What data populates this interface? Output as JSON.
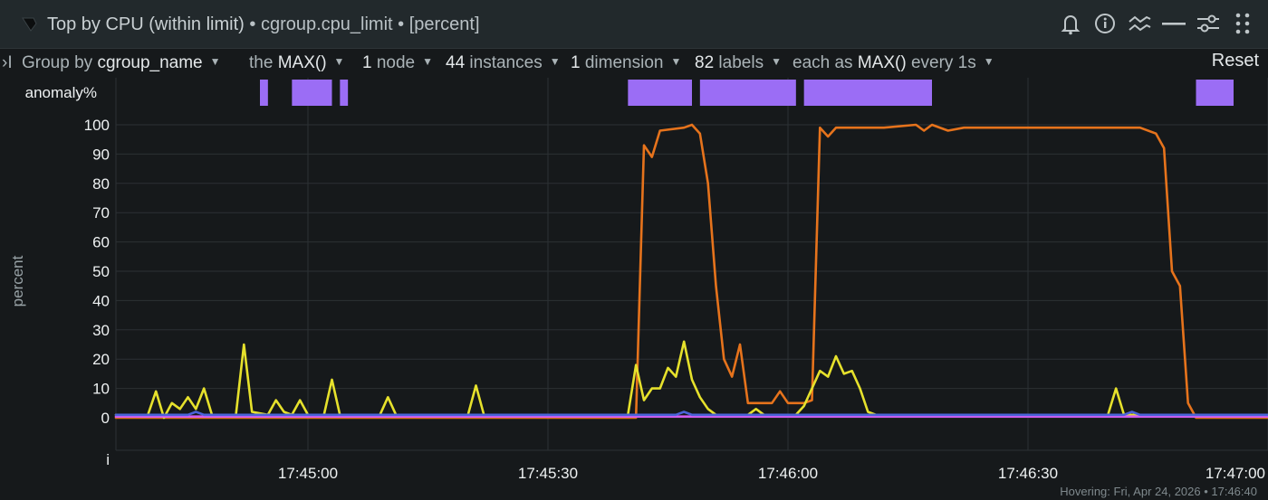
{
  "header": {
    "title_main": "Top by CPU (within limit)",
    "title_context": "• cgroup.cpu_limit",
    "title_units": "• [percent]",
    "icons": [
      "alert-bell-icon",
      "info-icon",
      "correlate-icon",
      "minimize-icon",
      "settings-sliders-icon",
      "drag-handle-icon"
    ]
  },
  "toolbar": {
    "expand_label": "›I",
    "group_by_label": "Group by",
    "group_by_value": "cgroup_name",
    "the_label": "the",
    "aggregation_value": "MAX()",
    "nodes_count": "1",
    "nodes_label": "node",
    "instances_count": "44",
    "instances_label": "instances",
    "dimensions_count": "1",
    "dimensions_label": "dimension",
    "labels_count": "82",
    "labels_label": "labels",
    "each_as_label": "each as",
    "time_agg_value": "MAX()",
    "every_label": "every 1s",
    "reset_label": "Reset"
  },
  "footer": {
    "hovering_text": "Hovering:  Fri, Apr 24, 2026 • 17:46:40"
  },
  "colors": {
    "background": "#16191b",
    "grid": "#2c3134",
    "anomaly": "#9b6df5",
    "orange": "#e6731c",
    "yellow": "#e6e12c",
    "magenta": "#d25cf0",
    "blue": "#4a63d8"
  },
  "chart_data": {
    "type": "line",
    "ylabel": "percent",
    "ylim": [
      0,
      100
    ],
    "yticks": [
      0,
      10,
      20,
      30,
      40,
      50,
      60,
      70,
      80,
      90,
      100
    ],
    "xlim_seconds": [
      "17:44:36",
      "17:47:00"
    ],
    "xticks": [
      "17:45:00",
      "17:45:30",
      "17:46:00",
      "17:46:30",
      "17:47:00"
    ],
    "anomaly_row_label": "anomaly%",
    "info_row_label": "i",
    "anomaly_periods": [
      [
        "17:44:54",
        "17:44:55"
      ],
      [
        "17:44:58",
        "17:45:03"
      ],
      [
        "17:45:04",
        "17:45:05"
      ],
      [
        "17:45:40",
        "17:45:48"
      ],
      [
        "17:45:49",
        "17:46:01"
      ],
      [
        "17:46:02",
        "17:46:18"
      ],
      [
        "17:46:51",
        "17:47:01"
      ]
    ],
    "series": [
      {
        "color": "#e6731c",
        "points": [
          [
            "17:44:36",
            0
          ],
          [
            "17:45:05",
            0
          ],
          [
            "17:45:41",
            0
          ],
          [
            "17:45:42",
            93
          ],
          [
            "17:45:43",
            89
          ],
          [
            "17:45:44",
            98
          ],
          [
            "17:45:47",
            99
          ],
          [
            "17:45:48",
            100
          ],
          [
            "17:45:49",
            97
          ],
          [
            "17:45:50",
            80
          ],
          [
            "17:45:51",
            45
          ],
          [
            "17:45:52",
            20
          ],
          [
            "17:45:53",
            14
          ],
          [
            "17:45:54",
            25
          ],
          [
            "17:45:55",
            5
          ],
          [
            "17:45:56",
            5
          ],
          [
            "17:45:58",
            5
          ],
          [
            "17:45:59",
            9
          ],
          [
            "17:46:00",
            5
          ],
          [
            "17:46:02",
            5
          ],
          [
            "17:46:03",
            6
          ],
          [
            "17:46:04",
            99
          ],
          [
            "17:46:05",
            96
          ],
          [
            "17:46:06",
            99
          ],
          [
            "17:46:10",
            99
          ],
          [
            "17:46:12",
            99
          ],
          [
            "17:46:16",
            100
          ],
          [
            "17:46:17",
            98
          ],
          [
            "17:46:18",
            100
          ],
          [
            "17:46:20",
            98
          ],
          [
            "17:46:22",
            99
          ],
          [
            "17:46:30",
            99
          ],
          [
            "17:46:40",
            99
          ],
          [
            "17:46:44",
            99
          ],
          [
            "17:46:46",
            97
          ],
          [
            "17:46:47",
            92
          ],
          [
            "17:46:48",
            50
          ],
          [
            "17:46:49",
            45
          ],
          [
            "17:46:50",
            5
          ],
          [
            "17:46:51",
            0
          ],
          [
            "17:47:00",
            0
          ]
        ]
      },
      {
        "color": "#e6e12c",
        "points": [
          [
            "17:44:36",
            1
          ],
          [
            "17:44:40",
            1
          ],
          [
            "17:44:41",
            9
          ],
          [
            "17:44:42",
            0
          ],
          [
            "17:44:43",
            5
          ],
          [
            "17:44:44",
            3
          ],
          [
            "17:44:45",
            7
          ],
          [
            "17:44:46",
            3
          ],
          [
            "17:44:47",
            10
          ],
          [
            "17:44:48",
            1
          ],
          [
            "17:44:51",
            1
          ],
          [
            "17:44:52",
            25
          ],
          [
            "17:44:53",
            2
          ],
          [
            "17:44:55",
            1
          ],
          [
            "17:44:56",
            6
          ],
          [
            "17:44:57",
            2
          ],
          [
            "17:44:58",
            1
          ],
          [
            "17:44:59",
            6
          ],
          [
            "17:45:00",
            1
          ],
          [
            "17:45:02",
            1
          ],
          [
            "17:45:03",
            13
          ],
          [
            "17:45:04",
            1
          ],
          [
            "17:45:09",
            1
          ],
          [
            "17:45:10",
            7
          ],
          [
            "17:45:11",
            1
          ],
          [
            "17:45:20",
            1
          ],
          [
            "17:45:21",
            11
          ],
          [
            "17:45:22",
            1
          ],
          [
            "17:45:40",
            1
          ],
          [
            "17:45:41",
            18
          ],
          [
            "17:45:42",
            6
          ],
          [
            "17:45:43",
            10
          ],
          [
            "17:45:44",
            10
          ],
          [
            "17:45:45",
            17
          ],
          [
            "17:45:46",
            14
          ],
          [
            "17:45:47",
            26
          ],
          [
            "17:45:48",
            13
          ],
          [
            "17:45:49",
            7
          ],
          [
            "17:45:50",
            3
          ],
          [
            "17:45:51",
            1
          ],
          [
            "17:45:55",
            1
          ],
          [
            "17:45:56",
            3
          ],
          [
            "17:45:57",
            1
          ],
          [
            "17:46:01",
            1
          ],
          [
            "17:46:02",
            4
          ],
          [
            "17:46:04",
            16
          ],
          [
            "17:46:05",
            14
          ],
          [
            "17:46:06",
            21
          ],
          [
            "17:46:07",
            15
          ],
          [
            "17:46:08",
            16
          ],
          [
            "17:46:09",
            10
          ],
          [
            "17:46:10",
            2
          ],
          [
            "17:46:11",
            1
          ],
          [
            "17:46:40",
            1
          ],
          [
            "17:46:41",
            10
          ],
          [
            "17:46:42",
            1
          ],
          [
            "17:47:00",
            1
          ]
        ]
      },
      {
        "color": "#d25cf0",
        "points": [
          [
            "17:44:36",
            0.4
          ],
          [
            "17:47:00",
            0.4
          ]
        ]
      },
      {
        "color": "#4a63d8",
        "points": [
          [
            "17:44:36",
            1
          ],
          [
            "17:44:45",
            1
          ],
          [
            "17:44:46",
            2
          ],
          [
            "17:44:47",
            1
          ],
          [
            "17:45:46",
            1
          ],
          [
            "17:45:47",
            2
          ],
          [
            "17:45:48",
            1
          ],
          [
            "17:46:42",
            1
          ],
          [
            "17:46:43",
            2
          ],
          [
            "17:46:44",
            1
          ],
          [
            "17:47:00",
            1
          ]
        ]
      }
    ]
  }
}
